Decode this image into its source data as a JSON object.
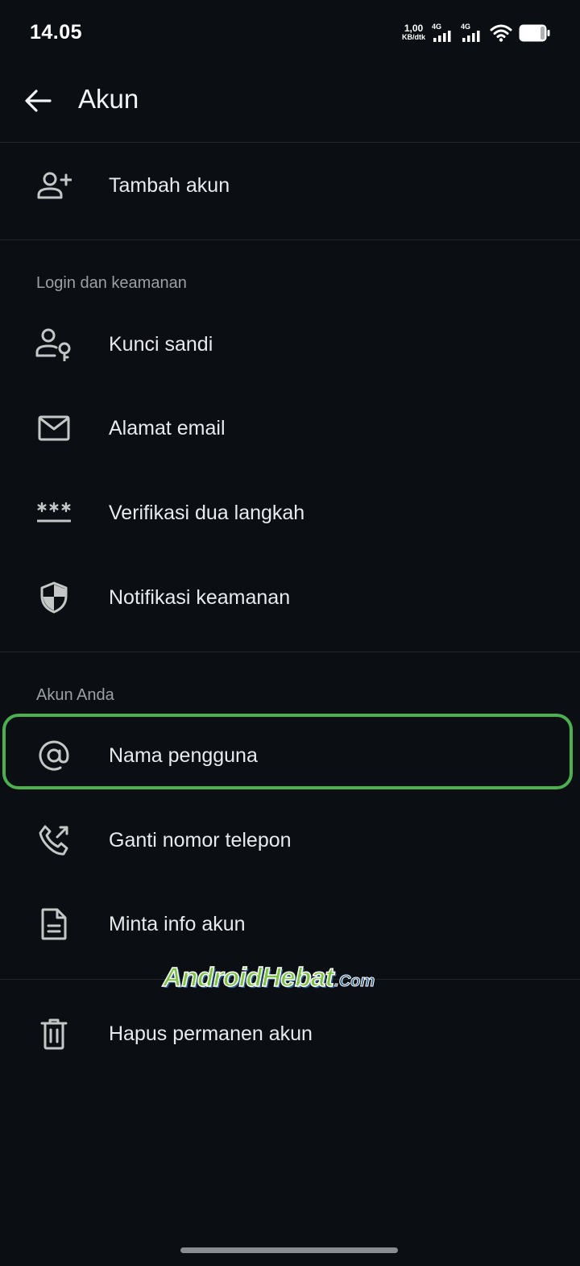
{
  "status_bar": {
    "time": "14.05",
    "net_speed_value": "1,00",
    "net_speed_unit": "KB/dtk",
    "sim1_label": "4G",
    "sim2_label": "4G",
    "wifi_icon": "wifi-icon",
    "battery_icon": "battery-icon"
  },
  "app_bar": {
    "back_icon": "arrow-back-icon",
    "title": "Akun"
  },
  "top_item": {
    "icon": "person-add-icon",
    "label": "Tambah akun"
  },
  "security_section": {
    "header": "Login dan keamanan",
    "items": [
      {
        "icon": "person-key-icon",
        "label": "Kunci sandi"
      },
      {
        "icon": "mail-icon",
        "label": "Alamat email"
      },
      {
        "icon": "password-icon",
        "label": "Verifikasi dua langkah"
      },
      {
        "icon": "shield-icon",
        "label": "Notifikasi keamanan"
      }
    ]
  },
  "account_section": {
    "header": "Akun Anda",
    "items": [
      {
        "icon": "at-sign-icon",
        "label": "Nama pengguna",
        "highlighted": true
      },
      {
        "icon": "phone-forwarded-icon",
        "label": "Ganti nomor telepon"
      },
      {
        "icon": "document-icon",
        "label": "Minta info akun"
      }
    ]
  },
  "delete_item": {
    "icon": "trash-icon",
    "label": "Hapus permanen akun"
  },
  "watermark": {
    "main": "AndroidHebat",
    "suffix": ".Com"
  },
  "colors": {
    "background": "#0b0f13",
    "text_primary": "#e8eaed",
    "text_secondary": "#9aa0a6",
    "icon": "#c4c7c5",
    "highlight_border": "#4caf50",
    "divider": "#23282d"
  }
}
